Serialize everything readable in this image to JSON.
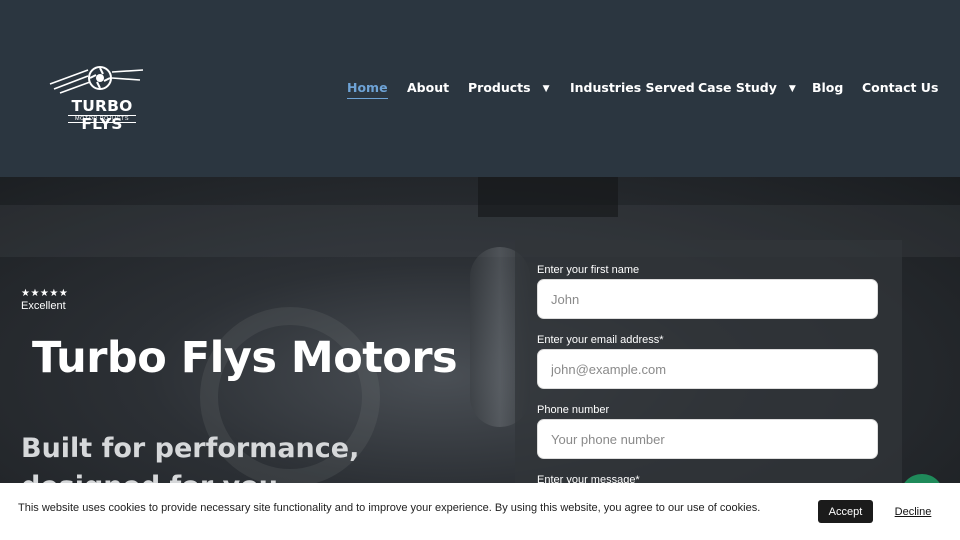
{
  "brand": {
    "name": "TURBO FLYS",
    "tagline": "MOTOR POJUCTS"
  },
  "nav": {
    "items": [
      {
        "label": "Home"
      },
      {
        "label": "About"
      },
      {
        "label": "Products"
      },
      {
        "label": "Industries Served"
      },
      {
        "label": "Case Study"
      },
      {
        "label": "Blog"
      },
      {
        "label": "Contact Us"
      }
    ],
    "active": "Home",
    "caret": "▼"
  },
  "hero": {
    "rating_stars": "★★★★★",
    "rating_label": "Excellent",
    "title": "Turbo Flys Motors",
    "subtitle": "Built for performance, designed for you."
  },
  "form": {
    "first_name_label": "Enter your first name",
    "first_name_placeholder": "John",
    "email_label": "Enter your email address*",
    "email_placeholder": "john@example.com",
    "phone_label": "Phone number",
    "phone_placeholder": "Your phone number",
    "message_label": "Enter your message*"
  },
  "cookie": {
    "text": "This website uses cookies to provide necessary site functionality and to improve your experience. By using this website, you agree to our use of cookies.",
    "accept": "Accept",
    "decline": "Decline"
  },
  "colors": {
    "header_bg": "#2b3640",
    "nav_active": "#6ea3d6",
    "chat_button": "#1f8a5a",
    "accept_bg": "#1b1b1b"
  }
}
